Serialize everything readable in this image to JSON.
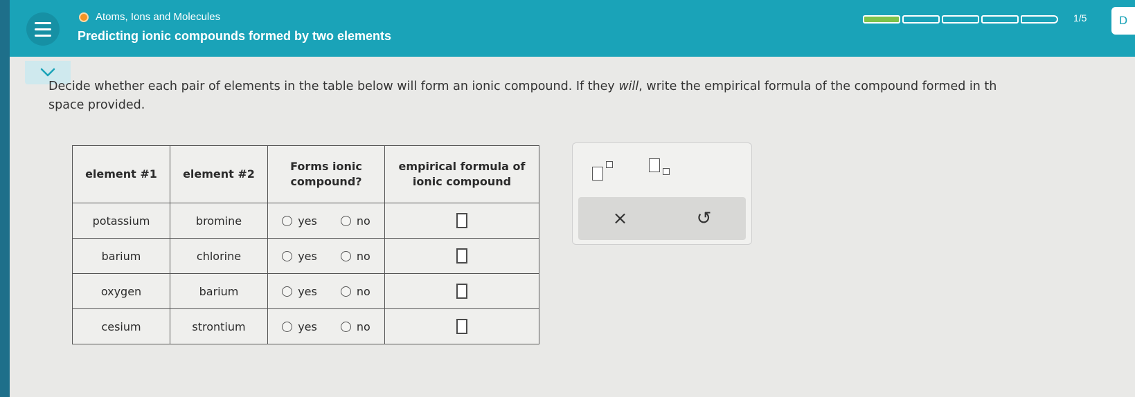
{
  "header": {
    "topic": "Atoms, Ions and Molecules",
    "title": "Predicting ionic compounds formed by two elements",
    "progress_label": "1/5",
    "progress_fraction": 0.2,
    "progress_segments": 5,
    "corner_glyph": "D",
    "colors": {
      "bar": "#1aa3b8",
      "progress_fill": "#7dc24b",
      "topic_dot": "#f39423"
    }
  },
  "instructions": {
    "part1": "Decide whether each pair of elements in the table below will form an ionic compound. If they ",
    "emph": "will",
    "part2": ", write the empirical formula of the compound formed in th",
    "line2": "space provided."
  },
  "table": {
    "headers": [
      "element #1",
      "element #2",
      "Forms ionic compound?",
      "empirical formula of ionic compound"
    ],
    "yes_label": "yes",
    "no_label": "no",
    "rows": [
      {
        "el1": "potassium",
        "el2": "bromine"
      },
      {
        "el1": "barium",
        "el2": "chlorine"
      },
      {
        "el1": "oxygen",
        "el2": "barium"
      },
      {
        "el1": "cesium",
        "el2": "strontium"
      }
    ]
  },
  "tools": {
    "superscript_icon": "superscript-icon",
    "subscript_icon": "subscript-icon",
    "clear_glyph": "×",
    "undo_glyph": "↺"
  }
}
